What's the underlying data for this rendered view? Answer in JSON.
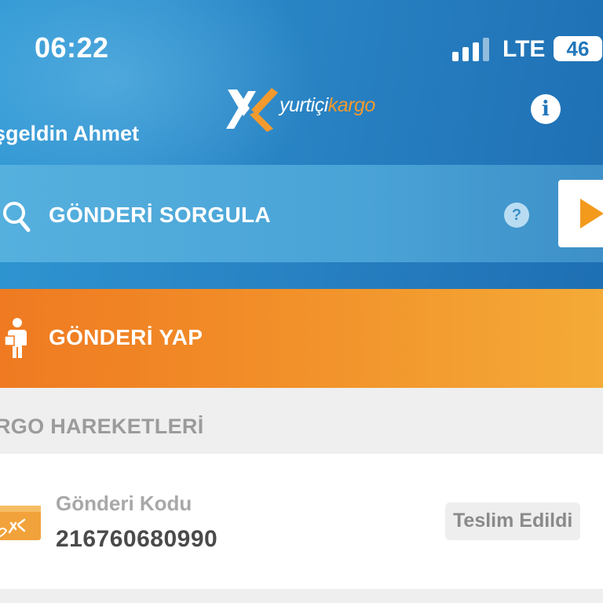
{
  "status_bar": {
    "time": "06:22",
    "network": "LTE",
    "battery": "46"
  },
  "header": {
    "logo": {
      "word_white": "yurtiçi",
      "word_orange": "kargo"
    },
    "welcome": "şgeldin Ahmet"
  },
  "search": {
    "label": "GÖNDERİ SORGULA",
    "help": "?"
  },
  "send": {
    "label": "GÖNDERİ YAP"
  },
  "movements": {
    "title": "RGO HAREKETLERİ",
    "items": [
      {
        "code_label": "Gönderi Kodu",
        "code": "216760680990",
        "status": "Teslim Edildi"
      }
    ]
  },
  "colors": {
    "brand_blue": "#2a86c6",
    "brand_orange": "#f39a2e",
    "send_orange": "#ef7a21"
  },
  "icons": {
    "info": "info-icon",
    "search": "search-icon",
    "help": "help-icon",
    "go": "play-triangle-icon",
    "send": "person-with-package-icon",
    "package": "package-icon"
  }
}
